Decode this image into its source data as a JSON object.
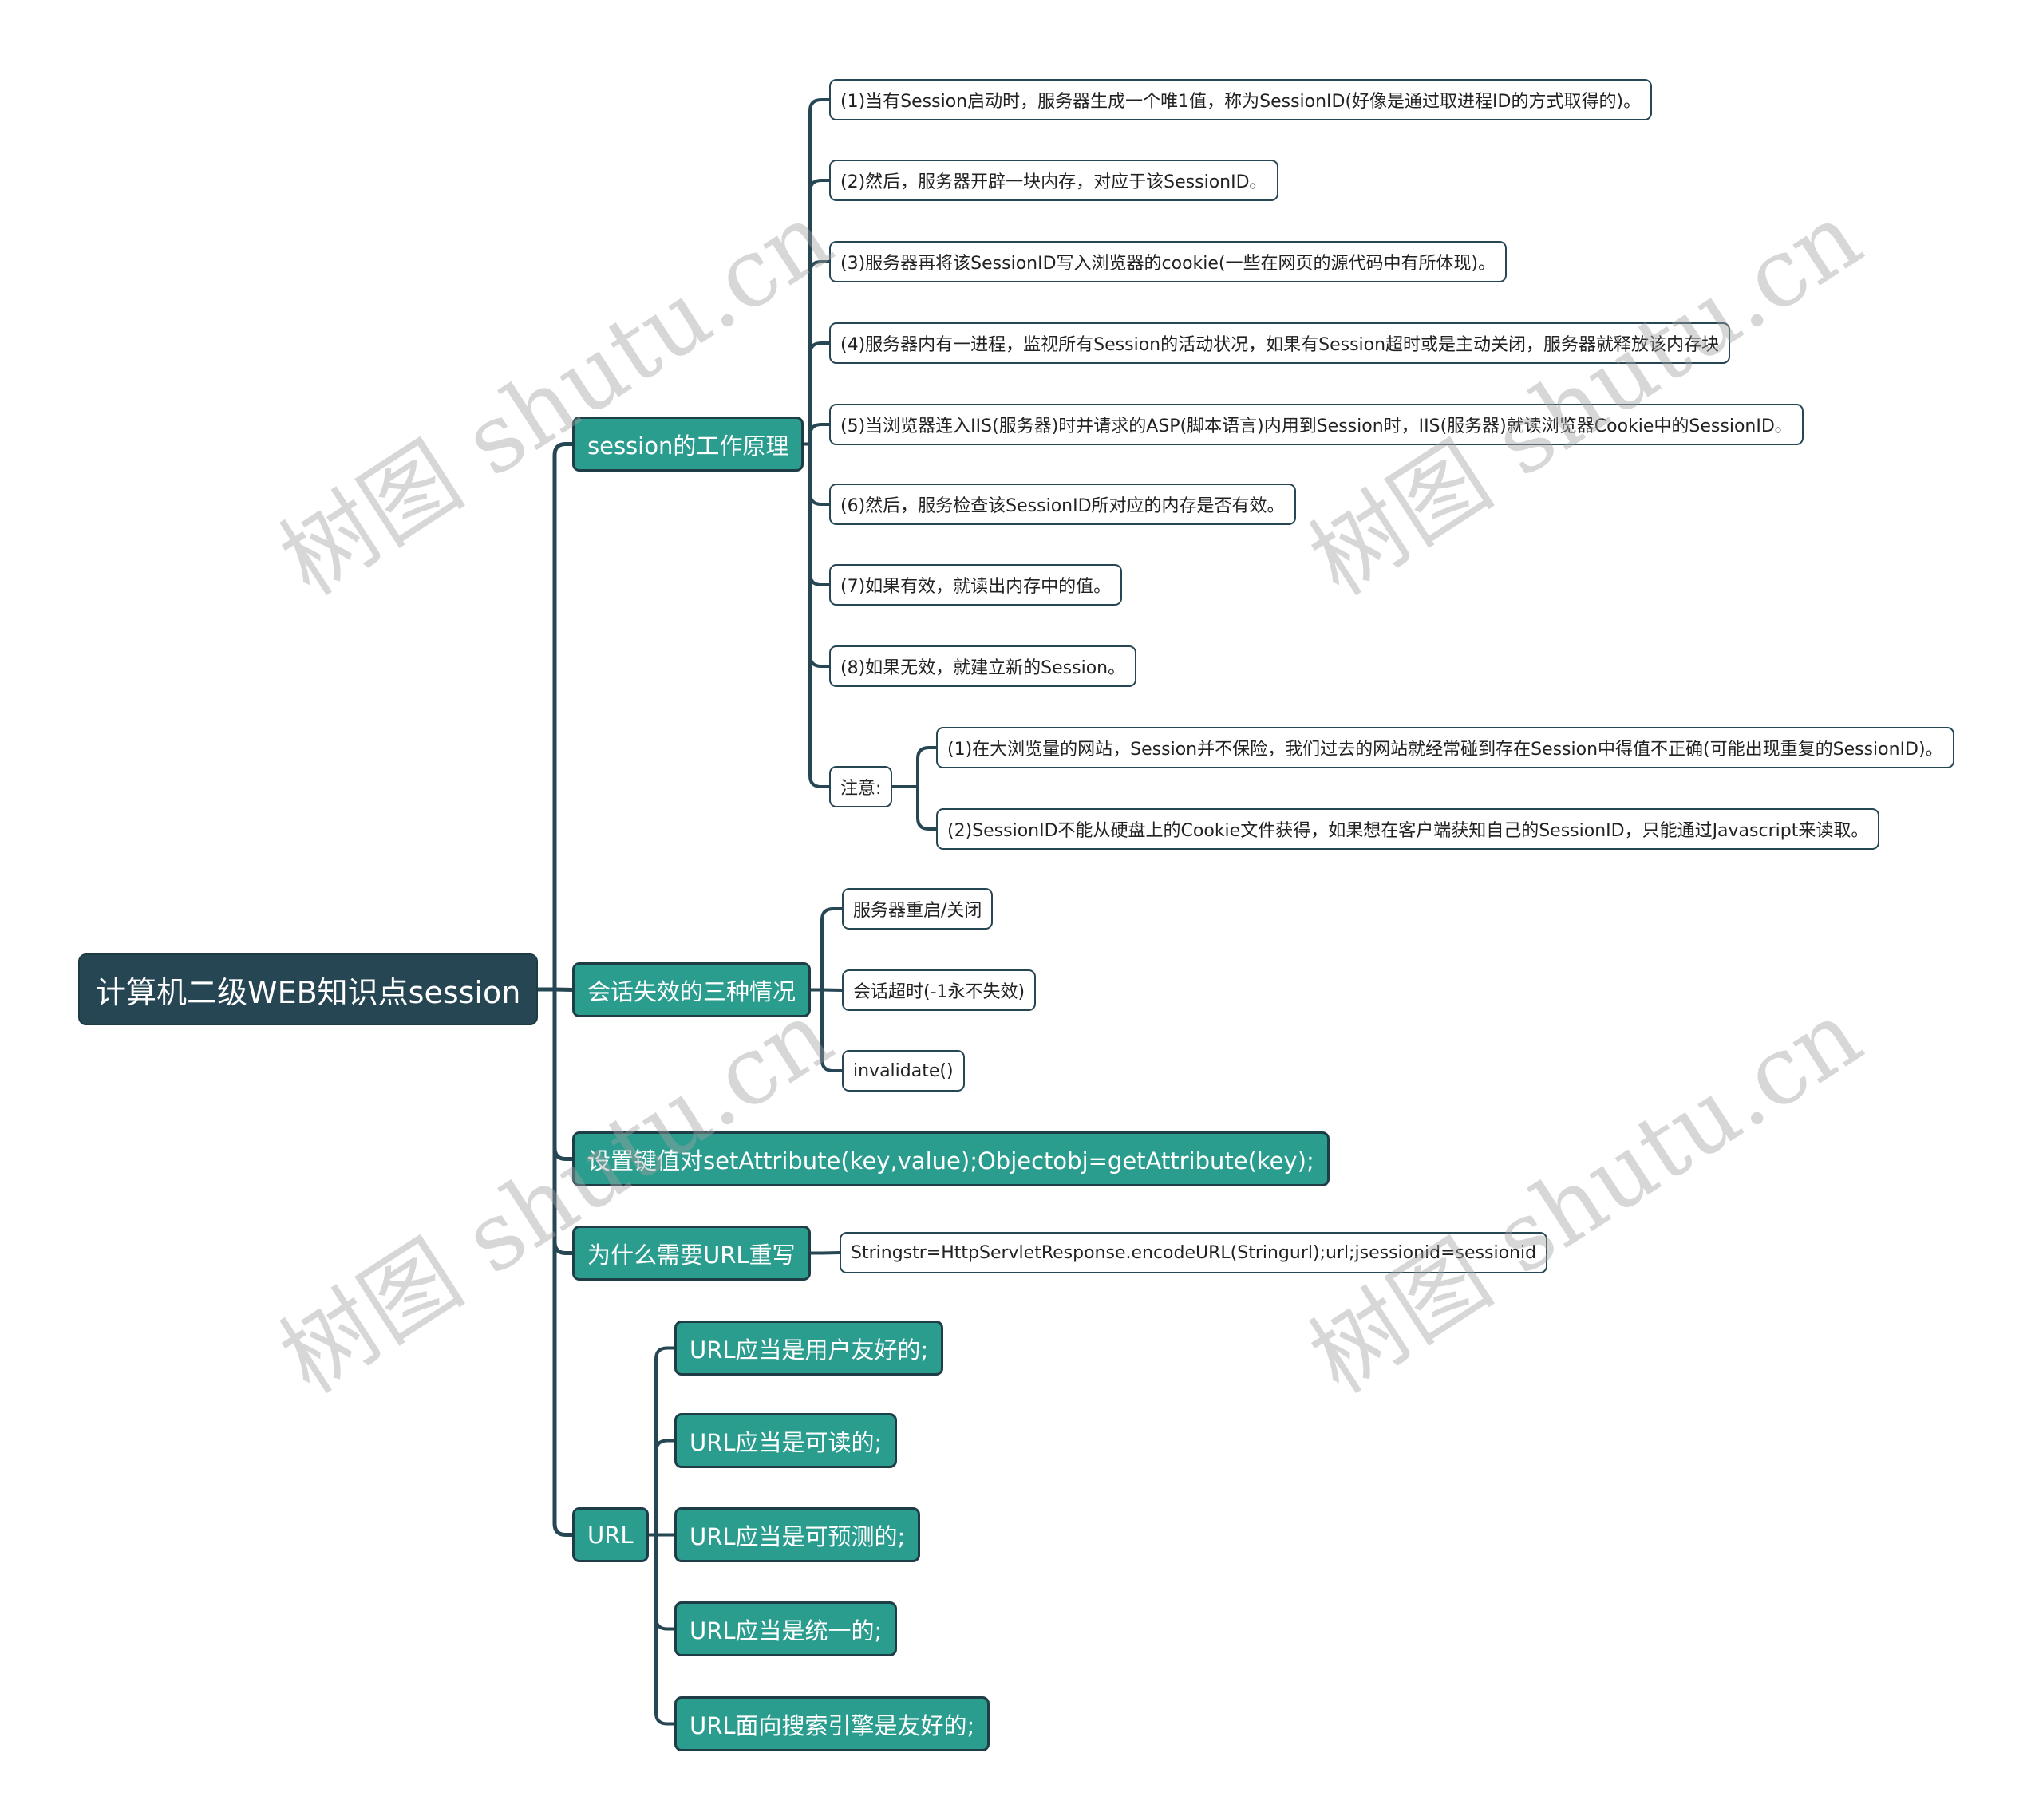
{
  "root": {
    "label": "计算机二级WEB知识点session"
  },
  "branches": {
    "principle": {
      "label": "session的工作原理",
      "items": [
        "(1)当有Session启动时，服务器生成一个唯1值，称为SessionID(好像是通过取进程ID的方式取得的)。",
        "(2)然后，服务器开辟一块内存，对应于该SessionID。",
        "(3)服务器再将该SessionID写入浏览器的cookie(一些在网页的源代码中有所体现)。",
        "(4)服务器内有一进程，监视所有Session的活动状况，如果有Session超时或是主动关闭，服务器就释放该内存块",
        "(5)当浏览器连入IIS(服务器)时并请求的ASP(脚本语言)内用到Session时，IIS(服务器)就读浏览器Cookie中的SessionID。",
        "(6)然后，服务检查该SessionID所对应的内存是否有效。",
        "(7)如果有效，就读出内存中的值。",
        "(8)如果无效，就建立新的Session。"
      ],
      "note": {
        "label": "注意:",
        "items": [
          "(1)在大浏览量的网站，Session并不保险，我们过去的网站就经常碰到存在Session中得值不正确(可能出现重复的SessionID)。",
          "(2)SessionID不能从硬盘上的Cookie文件获得，如果想在客户端获知自己的SessionID，只能通过Javascript来读取。"
        ]
      }
    },
    "invalidation": {
      "label": "会话失效的三种情况",
      "items": [
        "服务器重启/关闭",
        "会话超时(-1永不失效)",
        "invalidate()"
      ]
    },
    "keyvalue": {
      "label": "设置键值对setAttribute(key,value);Objectobj=getAttribute(key);"
    },
    "rewrite": {
      "label": "为什么需要URL重写",
      "items": [
        "Stringstr=HttpServletResponse.encodeURL(Stringurl);url;jsessionid=sessionid"
      ]
    },
    "url": {
      "label": "URL",
      "items": [
        "URL应当是用户友好的;",
        "URL应当是可读的;",
        "URL应当是可预测的;",
        "URL应当是统一的;",
        "URL面向搜索引擎是友好的;"
      ]
    }
  },
  "watermark": {
    "text": "树图 shutu.cn"
  },
  "colors": {
    "root": "#264653",
    "branch": "#2a9d8f",
    "line": "#264653",
    "leaf_border": "#264653"
  }
}
